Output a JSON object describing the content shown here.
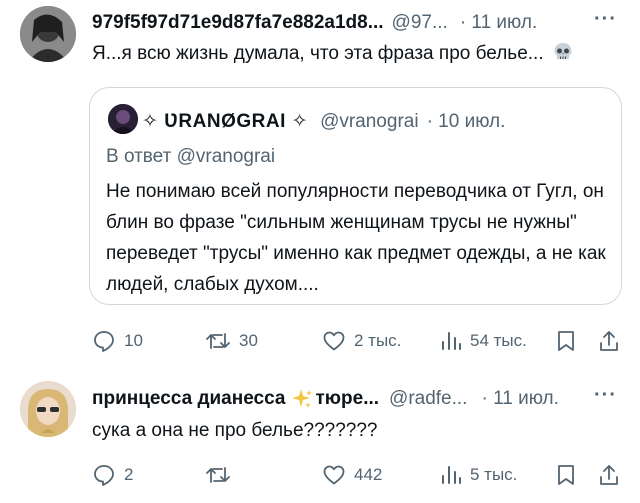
{
  "post1": {
    "display_name": "979f5f97d71e9d87fa7e882a1d8...",
    "handle": "@97...",
    "date": "· 11 июл.",
    "text": "Я...я всю жизнь думала, что эта фраза про белье...",
    "emoji": "skull",
    "quote": {
      "display_name": "✧ ƲRANØGRAI ✧",
      "handle": "@vranograi",
      "date": "· 10 июл.",
      "reply_to": "В ответ @vranograi",
      "text": "Не понимаю всей популярности переводчика от Гугл, он блин во фразе \"сильным женщинам трусы не нужны\" переведет \"трусы\" именно как предмет одежды, а не как людей, слабых духом...."
    },
    "stats": {
      "replies": "10",
      "reposts": "30",
      "likes": "2 тыс.",
      "views": "54 тыс."
    }
  },
  "post2": {
    "display_name": "принцесса дианесса",
    "name_suffix": "тюре...",
    "handle": "@radfe...",
    "date": "· 11 июл.",
    "text": "сука а она не про белье???????",
    "stats": {
      "replies": "2",
      "reposts": "",
      "likes": "442",
      "views": "5 тыс."
    }
  },
  "colors": {
    "text": "#0f1419",
    "muted": "#536471",
    "border": "#cfd9de",
    "sparkle": "#f4c542"
  },
  "icons": [
    "reply-icon",
    "repost-icon",
    "like-icon",
    "views-icon",
    "bookmark-icon",
    "share-icon",
    "more-icon",
    "skull-emoji",
    "sparkles-emoji"
  ]
}
